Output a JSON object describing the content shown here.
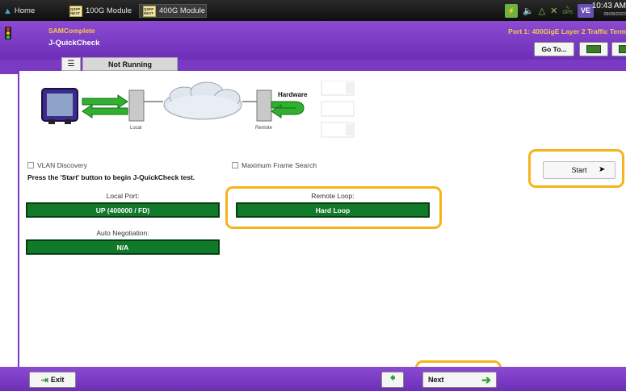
{
  "tabs": {
    "home": "Home",
    "module_100g": "100G Module",
    "module_400g": "400G Module",
    "chip_text": "QSFP NEXT"
  },
  "status": {
    "clock": "10:43 AM",
    "date": "09/28/2022",
    "ve_badge": "VE",
    "gps_label": "GPS"
  },
  "header": {
    "app_title": "SAMComplete",
    "app_subtitle": "J-QuickCheck",
    "port_info": "Port 1: 400GigE Layer 2 Traffic Term",
    "goto_label": "Go To..."
  },
  "test_status": "Not Running",
  "diagram": {
    "local_label": "Local",
    "remote_label": "Remote",
    "hardware_label": "Hardware"
  },
  "options": {
    "vlan_discovery": "VLAN Discovery",
    "max_frame_search": "Maximum Frame Search",
    "instruction": "Press the 'Start' button to begin J-QuickCheck test."
  },
  "fields": {
    "local_port_label": "Local Port:",
    "local_port_value": "UP (400000 / FD)",
    "remote_loop_label": "Remote Loop:",
    "remote_loop_value": "Hard Loop",
    "auto_neg_label": "Auto Negotiation:",
    "auto_neg_value": "N/A"
  },
  "actions": {
    "start": "Start",
    "exit": "Exit",
    "next": "Next"
  },
  "colors": {
    "header_purple": "#7a3ac2",
    "status_green": "#117a2a",
    "highlight": "#f5b41a",
    "title_yellow": "#f6c94b"
  }
}
